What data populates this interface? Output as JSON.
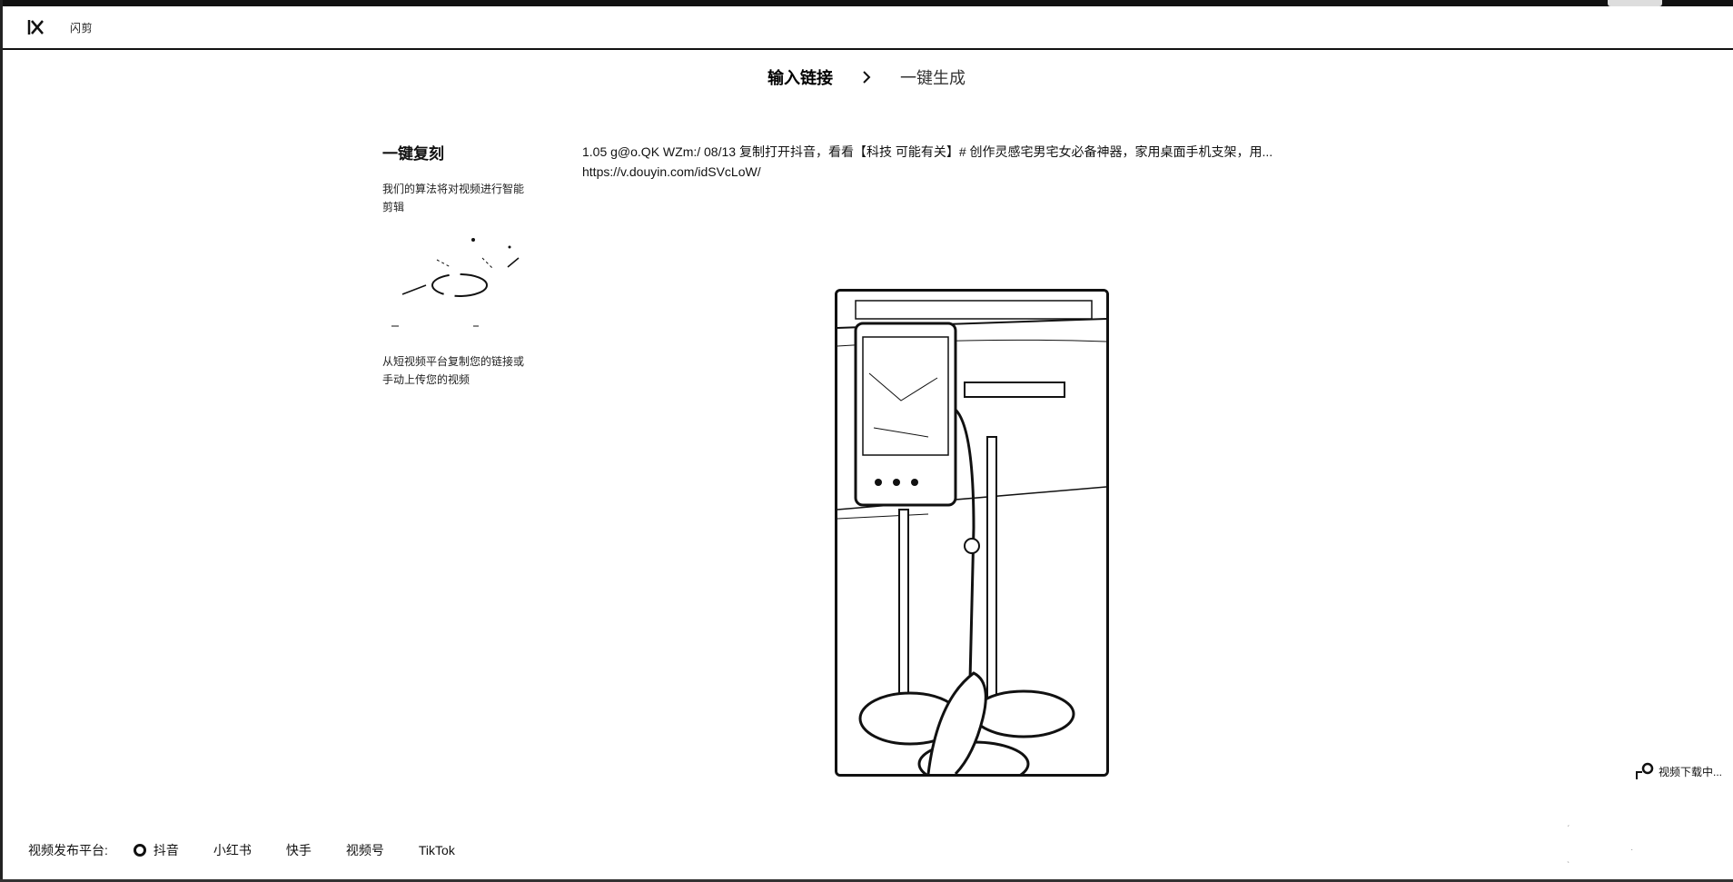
{
  "header": {
    "logo_icon": "app-logo-icon",
    "app_name": "闪剪"
  },
  "steps": [
    {
      "label": "输入链接",
      "state": "active"
    },
    {
      "label": "一键生成",
      "state": "inactive"
    }
  ],
  "sidebar": {
    "title": "一键复刻",
    "description": "我们的算法将对视频进行智能剪辑",
    "instruction": "从短视频平台复制您的链接或手动上传您的视频"
  },
  "link_input": {
    "line1": "1.05 g@o.QK WZm:/ 08/13  复制打开抖音，看看【科技 可能有关】# 创作灵感宅男宅女必备神器，家用桌面手机支架，用...",
    "line2": "https://v.douyin.com/idSVcLoW/"
  },
  "video_preview": {
    "description_icon": "video-thumbnail"
  },
  "download_status": {
    "label": "视频下载中..."
  },
  "platform_bar": {
    "label": "视频发布平台:",
    "options": [
      {
        "label": "抖音",
        "selected": true
      },
      {
        "label": "小红书",
        "selected": false
      },
      {
        "label": "快手",
        "selected": false
      },
      {
        "label": "视频号",
        "selected": false
      },
      {
        "label": "TikTok",
        "selected": false
      }
    ]
  }
}
